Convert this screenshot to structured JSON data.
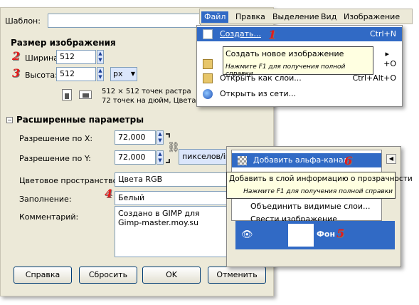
{
  "dialog": {
    "template_label": "Шаблон:",
    "image_size_header": "Размер изображения",
    "width_label": "Ширина:",
    "width_value": "512",
    "height_label": "Высота:",
    "height_value": "512",
    "unit": "px",
    "size_info_line1": "512 × 512 точек растра",
    "size_info_line2": "72 точек на дюйм, Цвета RGB",
    "advanced_header": "Расширенные параметры",
    "xres_label": "Разрешение по X:",
    "xres_value": "72,000",
    "yres_label": "Разрешение по Y:",
    "yres_value": "72,000",
    "res_unit": "пикселов/in",
    "colorspace_label": "Цветовое пространство:",
    "colorspace_value": "Цвета RGB",
    "fill_label": "Заполнение:",
    "fill_value": "Белый",
    "comment_label": "Комментарий:",
    "comment_line1": "Создано в GIMP для",
    "comment_line2": "Gimp-master.moy.su",
    "buttons": {
      "help": "Справка",
      "reset": "Сбросить",
      "ok": "OK",
      "cancel": "Отменить"
    }
  },
  "menubar": {
    "items": [
      "Файл",
      "Правка",
      "Выделение",
      "Вид",
      "Изображение"
    ]
  },
  "file_menu": {
    "create_label": "Создать...",
    "create_shortcut": "Ctrl+N",
    "tooltip_line1": "Создать новое изображение",
    "tooltip_line2": "Нажмите F1 для получения полной справки",
    "hidden_shortcut1": "+O",
    "open_layers_label": "Открыть как слои...",
    "open_layers_shortcut": "Ctrl+Alt+O",
    "open_url_label": "Открыть из сети..."
  },
  "layers_menu": {
    "add_alpha_label": "Добавить альфа-канал",
    "tooltip_line1": "Добавить в слой информацию о прозрачности",
    "tooltip_line2": "Нажмите F1 для получения полной справки",
    "merge_visible_label": "Объединить видимые слои...",
    "flatten_label": "Свести изображение",
    "layer_name": "Фон"
  },
  "markers": [
    "1",
    "2",
    "3",
    "4",
    "5",
    "6"
  ],
  "colors": {
    "dialog_bg": "#ece9d8",
    "highlight": "#316ac5",
    "tooltip_bg": "#ffffe1",
    "marker_red": "#e31b1b"
  }
}
